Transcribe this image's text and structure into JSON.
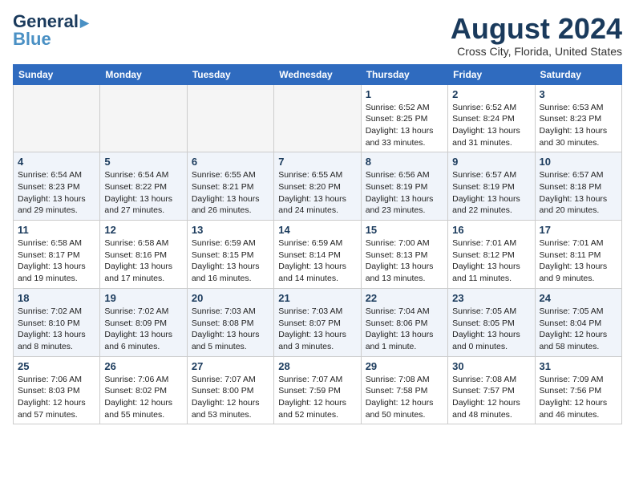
{
  "header": {
    "logo_line1": "General",
    "logo_line2": "Blue",
    "month_title": "August 2024",
    "location": "Cross City, Florida, United States"
  },
  "weekdays": [
    "Sunday",
    "Monday",
    "Tuesday",
    "Wednesday",
    "Thursday",
    "Friday",
    "Saturday"
  ],
  "weeks": [
    [
      {
        "day": "",
        "info": ""
      },
      {
        "day": "",
        "info": ""
      },
      {
        "day": "",
        "info": ""
      },
      {
        "day": "",
        "info": ""
      },
      {
        "day": "1",
        "info": "Sunrise: 6:52 AM\nSunset: 8:25 PM\nDaylight: 13 hours\nand 33 minutes."
      },
      {
        "day": "2",
        "info": "Sunrise: 6:52 AM\nSunset: 8:24 PM\nDaylight: 13 hours\nand 31 minutes."
      },
      {
        "day": "3",
        "info": "Sunrise: 6:53 AM\nSunset: 8:23 PM\nDaylight: 13 hours\nand 30 minutes."
      }
    ],
    [
      {
        "day": "4",
        "info": "Sunrise: 6:54 AM\nSunset: 8:23 PM\nDaylight: 13 hours\nand 29 minutes."
      },
      {
        "day": "5",
        "info": "Sunrise: 6:54 AM\nSunset: 8:22 PM\nDaylight: 13 hours\nand 27 minutes."
      },
      {
        "day": "6",
        "info": "Sunrise: 6:55 AM\nSunset: 8:21 PM\nDaylight: 13 hours\nand 26 minutes."
      },
      {
        "day": "7",
        "info": "Sunrise: 6:55 AM\nSunset: 8:20 PM\nDaylight: 13 hours\nand 24 minutes."
      },
      {
        "day": "8",
        "info": "Sunrise: 6:56 AM\nSunset: 8:19 PM\nDaylight: 13 hours\nand 23 minutes."
      },
      {
        "day": "9",
        "info": "Sunrise: 6:57 AM\nSunset: 8:19 PM\nDaylight: 13 hours\nand 22 minutes."
      },
      {
        "day": "10",
        "info": "Sunrise: 6:57 AM\nSunset: 8:18 PM\nDaylight: 13 hours\nand 20 minutes."
      }
    ],
    [
      {
        "day": "11",
        "info": "Sunrise: 6:58 AM\nSunset: 8:17 PM\nDaylight: 13 hours\nand 19 minutes."
      },
      {
        "day": "12",
        "info": "Sunrise: 6:58 AM\nSunset: 8:16 PM\nDaylight: 13 hours\nand 17 minutes."
      },
      {
        "day": "13",
        "info": "Sunrise: 6:59 AM\nSunset: 8:15 PM\nDaylight: 13 hours\nand 16 minutes."
      },
      {
        "day": "14",
        "info": "Sunrise: 6:59 AM\nSunset: 8:14 PM\nDaylight: 13 hours\nand 14 minutes."
      },
      {
        "day": "15",
        "info": "Sunrise: 7:00 AM\nSunset: 8:13 PM\nDaylight: 13 hours\nand 13 minutes."
      },
      {
        "day": "16",
        "info": "Sunrise: 7:01 AM\nSunset: 8:12 PM\nDaylight: 13 hours\nand 11 minutes."
      },
      {
        "day": "17",
        "info": "Sunrise: 7:01 AM\nSunset: 8:11 PM\nDaylight: 13 hours\nand 9 minutes."
      }
    ],
    [
      {
        "day": "18",
        "info": "Sunrise: 7:02 AM\nSunset: 8:10 PM\nDaylight: 13 hours\nand 8 minutes."
      },
      {
        "day": "19",
        "info": "Sunrise: 7:02 AM\nSunset: 8:09 PM\nDaylight: 13 hours\nand 6 minutes."
      },
      {
        "day": "20",
        "info": "Sunrise: 7:03 AM\nSunset: 8:08 PM\nDaylight: 13 hours\nand 5 minutes."
      },
      {
        "day": "21",
        "info": "Sunrise: 7:03 AM\nSunset: 8:07 PM\nDaylight: 13 hours\nand 3 minutes."
      },
      {
        "day": "22",
        "info": "Sunrise: 7:04 AM\nSunset: 8:06 PM\nDaylight: 13 hours\nand 1 minute."
      },
      {
        "day": "23",
        "info": "Sunrise: 7:05 AM\nSunset: 8:05 PM\nDaylight: 13 hours\nand 0 minutes."
      },
      {
        "day": "24",
        "info": "Sunrise: 7:05 AM\nSunset: 8:04 PM\nDaylight: 12 hours\nand 58 minutes."
      }
    ],
    [
      {
        "day": "25",
        "info": "Sunrise: 7:06 AM\nSunset: 8:03 PM\nDaylight: 12 hours\nand 57 minutes."
      },
      {
        "day": "26",
        "info": "Sunrise: 7:06 AM\nSunset: 8:02 PM\nDaylight: 12 hours\nand 55 minutes."
      },
      {
        "day": "27",
        "info": "Sunrise: 7:07 AM\nSunset: 8:00 PM\nDaylight: 12 hours\nand 53 minutes."
      },
      {
        "day": "28",
        "info": "Sunrise: 7:07 AM\nSunset: 7:59 PM\nDaylight: 12 hours\nand 52 minutes."
      },
      {
        "day": "29",
        "info": "Sunrise: 7:08 AM\nSunset: 7:58 PM\nDaylight: 12 hours\nand 50 minutes."
      },
      {
        "day": "30",
        "info": "Sunrise: 7:08 AM\nSunset: 7:57 PM\nDaylight: 12 hours\nand 48 minutes."
      },
      {
        "day": "31",
        "info": "Sunrise: 7:09 AM\nSunset: 7:56 PM\nDaylight: 12 hours\nand 46 minutes."
      }
    ]
  ]
}
